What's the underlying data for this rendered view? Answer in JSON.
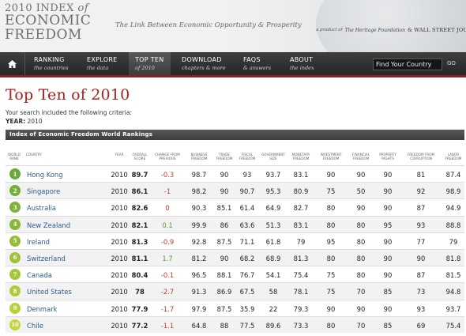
{
  "header": {
    "logo_line1": "2010 INDEX",
    "logo_of": "of",
    "logo_line2": "ECONOMIC",
    "logo_line3": "FREEDOM",
    "tagline": "The Link Between Economic Opportunity & Prosperity",
    "partner_prefix": "a product of",
    "partner_heritage": "The Heritage Foundation",
    "partner_wsj": "& WALL STREET JOURNAL"
  },
  "nav": {
    "home_icon": "house-icon",
    "items": [
      {
        "title": "RANKING",
        "sub": "the countries"
      },
      {
        "title": "EXPLORE",
        "sub": "the data"
      },
      {
        "title": "TOP TEN",
        "sub": "of 2010"
      },
      {
        "title": "DOWNLOAD",
        "sub": "chapters & more"
      },
      {
        "title": "FAQS",
        "sub": "& answers"
      },
      {
        "title": "ABOUT",
        "sub": "the index"
      }
    ],
    "active_index": 2,
    "search_value": "Find Your Country",
    "go_label": "GO"
  },
  "page": {
    "title": "Top Ten of 2010",
    "criteria_text": "Your search included the following criteria:",
    "year_label": "YEAR:",
    "year_value": "2010"
  },
  "table": {
    "bar_title": "Index of Economic Freedom World Rankings",
    "headers": {
      "world_rank": "WORLD RANK",
      "country": "COUNTRY",
      "year": "YEAR",
      "overall": "OVERALL SCORE",
      "change": "CHANGE FROM PREVIOUS",
      "business": "BUSINESS FREEDOM",
      "trade": "TRADE FREEDOM",
      "fiscal": "FISCAL FREEDOM",
      "government": "GOVERNMENT SIZE",
      "monetary": "MONETARY FREEDOM",
      "investment": "INVESTMENT FREEDOM",
      "financial": "FINANCIAL FREEDOM",
      "property": "PROPERTY RIGHTS",
      "corruption": "FREEDOM FROM CORRUPTION",
      "labor": "LABOR FREEDOM"
    },
    "rows": [
      {
        "rank": "1",
        "country": "Hong Kong",
        "year": "2010",
        "overall": "89.7",
        "change": "-0.3",
        "business": "98.7",
        "trade": "90",
        "fiscal": "93",
        "government": "93.7",
        "monetary": "83.1",
        "investment": "90",
        "financial": "90",
        "property": "90",
        "corruption": "81",
        "labor": "87.4"
      },
      {
        "rank": "2",
        "country": "Singapore",
        "year": "2010",
        "overall": "86.1",
        "change": "-1",
        "business": "98.2",
        "trade": "90",
        "fiscal": "90.7",
        "government": "95.3",
        "monetary": "80.9",
        "investment": "75",
        "financial": "50",
        "property": "90",
        "corruption": "92",
        "labor": "98.9"
      },
      {
        "rank": "3",
        "country": "Australia",
        "year": "2010",
        "overall": "82.6",
        "change": "0",
        "business": "90.3",
        "trade": "85.1",
        "fiscal": "61.4",
        "government": "64.9",
        "monetary": "82.7",
        "investment": "80",
        "financial": "90",
        "property": "90",
        "corruption": "87",
        "labor": "94.9"
      },
      {
        "rank": "4",
        "country": "New Zealand",
        "year": "2010",
        "overall": "82.1",
        "change": "0.1",
        "business": "99.9",
        "trade": "86",
        "fiscal": "63.6",
        "government": "51.3",
        "monetary": "83.1",
        "investment": "80",
        "financial": "80",
        "property": "95",
        "corruption": "93",
        "labor": "88.8"
      },
      {
        "rank": "5",
        "country": "Ireland",
        "year": "2010",
        "overall": "81.3",
        "change": "-0.9",
        "business": "92.8",
        "trade": "87.5",
        "fiscal": "71.1",
        "government": "61.8",
        "monetary": "79",
        "investment": "95",
        "financial": "80",
        "property": "90",
        "corruption": "77",
        "labor": "79"
      },
      {
        "rank": "6",
        "country": "Switzerland",
        "year": "2010",
        "overall": "81.1",
        "change": "1.7",
        "business": "81.2",
        "trade": "90",
        "fiscal": "68.2",
        "government": "68.9",
        "monetary": "81.3",
        "investment": "80",
        "financial": "80",
        "property": "90",
        "corruption": "90",
        "labor": "81.8"
      },
      {
        "rank": "7",
        "country": "Canada",
        "year": "2010",
        "overall": "80.4",
        "change": "-0.1",
        "business": "96.5",
        "trade": "88.1",
        "fiscal": "76.7",
        "government": "54.1",
        "monetary": "75.4",
        "investment": "75",
        "financial": "80",
        "property": "90",
        "corruption": "87",
        "labor": "81.5"
      },
      {
        "rank": "8",
        "country": "United States",
        "year": "2010",
        "overall": "78",
        "change": "-2.7",
        "business": "91.3",
        "trade": "86.9",
        "fiscal": "67.5",
        "government": "58",
        "monetary": "78.1",
        "investment": "75",
        "financial": "70",
        "property": "85",
        "corruption": "73",
        "labor": "94.8"
      },
      {
        "rank": "9",
        "country": "Denmark",
        "year": "2010",
        "overall": "77.9",
        "change": "-1.7",
        "business": "97.9",
        "trade": "87.5",
        "fiscal": "35.9",
        "government": "22",
        "monetary": "79.3",
        "investment": "90",
        "financial": "90",
        "property": "90",
        "corruption": "93",
        "labor": "93.7"
      },
      {
        "rank": "10",
        "country": "Chile",
        "year": "2010",
        "overall": "77.2",
        "change": "-1.1",
        "business": "64.8",
        "trade": "88",
        "fiscal": "77.5",
        "government": "89.6",
        "monetary": "73.3",
        "investment": "80",
        "financial": "70",
        "property": "85",
        "corruption": "69",
        "labor": "75.4"
      }
    ]
  },
  "colors": {
    "accent_red": "#a3211e",
    "rank_green_start": "#7cb342",
    "rank_green_end": "#c0ca33",
    "negative_change": "#c0392b",
    "positive_change": "#5c9a2b"
  }
}
